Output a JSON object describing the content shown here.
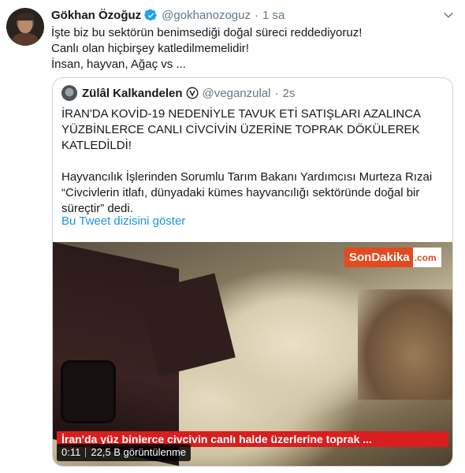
{
  "tweet": {
    "display_name": "Gökhan Özoğuz",
    "handle": "@gokhanozoguz",
    "separator": "·",
    "time": "1 sa",
    "lines": [
      "İşte biz bu sektörün benimsediği doğal süreci reddediyoruz!",
      "Canlı olan hiçbirşey katledilmemelidir!",
      "İnsan, hayvan, Ağaç vs ..."
    ]
  },
  "quote": {
    "display_name": "Zülâl Kalkandelen",
    "badge_glyph": "ⓥ",
    "handle": "@veganzulal",
    "separator": "·",
    "time": "2s",
    "headline_lines": [
      "İRAN'DA KOVİD-19 NEDENİYLE TAVUK ETİ SATIŞLARI AZALINCA",
      "YÜZBİNLERCE CANLI CİVCİVİN ÜZERİNE TOPRAK DÖKÜLEREK",
      "KATLEDİLDİ!"
    ],
    "body_lines": [
      "Hayvancılık İşlerinden Sorumlu Tarım Bakanı Yardımcısı Murteza Rızai",
      "“Civcivlerin itlafı, dünyadaki kümes hayvancılığı sektöründe doğal bir",
      "süreçtir” dedi."
    ],
    "thread_link": "Bu Tweet dizisini göster"
  },
  "media": {
    "logo_part1": "SonDakika",
    "logo_part2": ".com",
    "caption": "İran'da yüz binlerce civcivin canlı halde üzerlerine toprak ...",
    "duration": "0:11",
    "views": "22,5 B görüntülenme"
  },
  "colors": {
    "verified": "#1da1f2",
    "link": "#1b95e0",
    "muted": "#657786",
    "caption_red": "#d81e1e",
    "logo_orange": "#e34a1f"
  },
  "icons": {
    "verified": "verified-badge-icon",
    "caret": "chevron-down-icon",
    "vegan": "vegan-badge-icon"
  }
}
